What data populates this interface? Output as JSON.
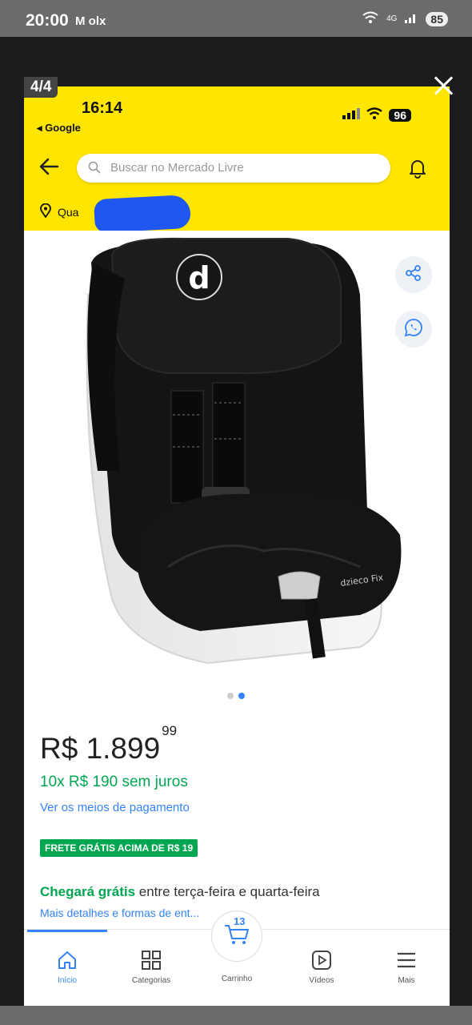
{
  "outer_status": {
    "time": "20:00",
    "apps": "M olx",
    "network": "4G",
    "battery": "85"
  },
  "viewer": {
    "counter": "4/4"
  },
  "inner_status": {
    "time": "16:14",
    "back_app": "◂ Google",
    "battery": "96"
  },
  "header": {
    "search_placeholder": "Buscar no Mercado Livre",
    "location_prefix": "Qua"
  },
  "product": {
    "price_main": "R$ 1.899",
    "price_cents": "99",
    "installments": "10x R$ 190 sem juros",
    "payment_link": "Ver os meios de pagamento",
    "frete_badge": "FRETE GRÁTIS ACIMA DE R$ 19",
    "delivery_bold": "Chegará grátis",
    "delivery_rest": " entre terça-feira e quarta-feira",
    "details_link": "Mais detalhes e formas de ent...",
    "seat_logo": "d",
    "seat_brand": "dzieco Fix"
  },
  "tabbar": {
    "inicio": "Início",
    "categorias": "Categorias",
    "carrinho": "Carrinho",
    "cart_count": "13",
    "videos": "Vídeos",
    "mais": "Mais"
  },
  "colors": {
    "ml_yellow": "#ffe600",
    "ml_blue": "#3483fa",
    "ml_green": "#00a650"
  }
}
